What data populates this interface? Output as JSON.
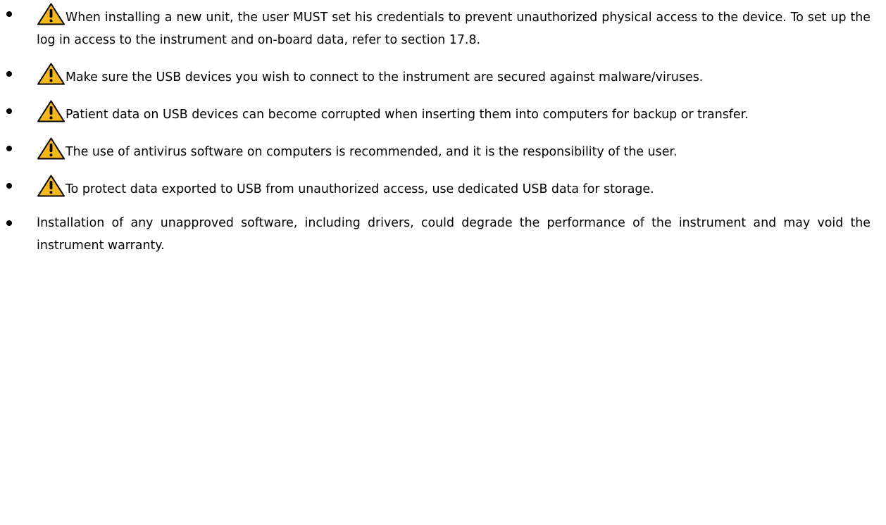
{
  "colors": {
    "warning_fill": "#F5B81C",
    "warning_stroke": "#000000",
    "text": "#000000",
    "background": "#FFFFFF"
  },
  "items": [
    {
      "icon": "warning-triangle-icon",
      "text": "When installing a new unit, the user MUST set his credentials to prevent unauthorized physical access to the device. To set up the log in access to the instrument and on-board data, refer to section 17.8."
    },
    {
      "icon": "warning-triangle-icon",
      "text": "Make sure the USB devices you wish to connect to the instrument are secured against malware/viruses."
    },
    {
      "icon": "warning-triangle-icon",
      "text": "Patient data on USB devices can become corrupted when inserting them into computers for backup or transfer."
    },
    {
      "icon": "warning-triangle-icon",
      "text": "The use of antivirus software on computers is recommended, and it is the responsibility of the user."
    },
    {
      "icon": "warning-triangle-icon",
      "text": "To protect data exported to USB from unauthorized access, use dedicated USB data for storage."
    },
    {
      "icon": "",
      "text": "Installation of any unapproved software, including drivers, could degrade the performance of the instrument and may void the instrument warranty."
    }
  ]
}
